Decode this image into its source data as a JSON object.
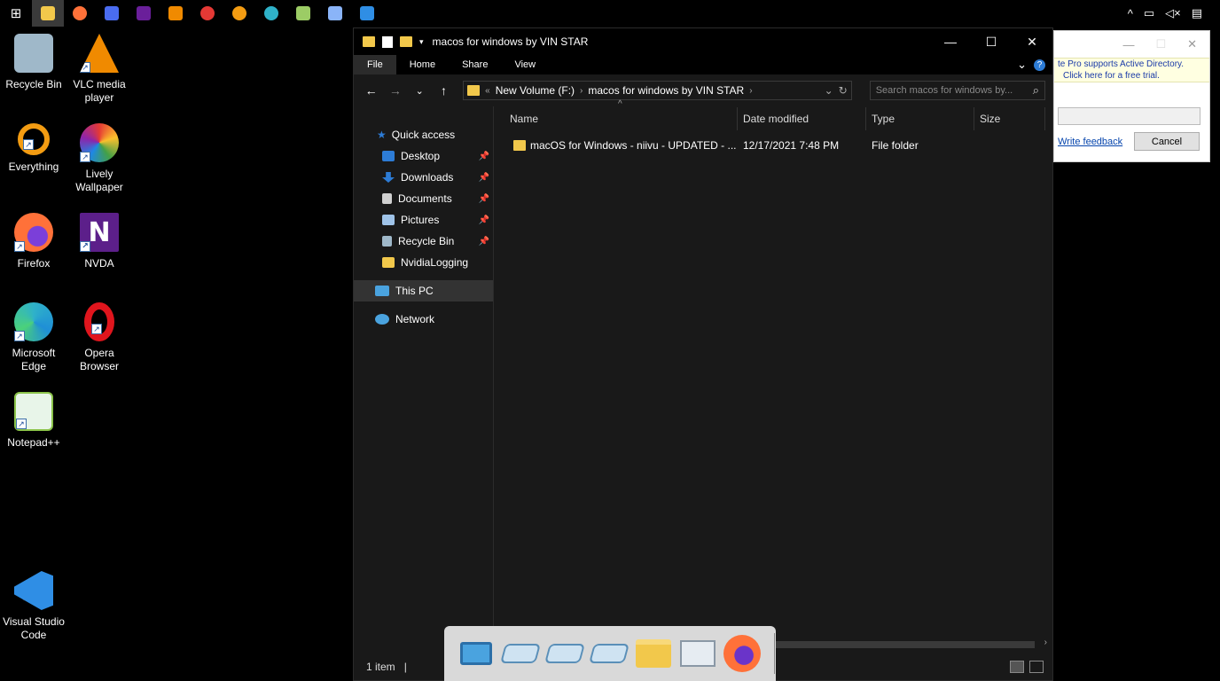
{
  "taskbar": {
    "apps": [
      {
        "name": "start-button",
        "icon": "windows-logo-icon",
        "color": "#ffffff"
      },
      {
        "name": "file-explorer",
        "icon": "folder-icon",
        "color": "#f2c84b",
        "active": true
      },
      {
        "name": "firefox",
        "icon": "firefox-icon",
        "color": "#ff7139"
      },
      {
        "name": "app-wizard",
        "icon": "wizard-icon",
        "color": "#4a6cf0"
      },
      {
        "name": "nvda",
        "icon": "nvda-icon",
        "color": "#6a1f9a"
      },
      {
        "name": "vlc",
        "icon": "vlc-icon",
        "color": "#f08a00"
      },
      {
        "name": "lively",
        "icon": "lively-icon",
        "color": "#e53935"
      },
      {
        "name": "everything",
        "icon": "everything-icon",
        "color": "#f39c12"
      },
      {
        "name": "edge",
        "icon": "edge-icon",
        "color": "#2fb2c9"
      },
      {
        "name": "notepadpp",
        "icon": "notepad-icon",
        "color": "#9ccc65"
      },
      {
        "name": "docker",
        "icon": "whale-icon",
        "color": "#8ab4f8"
      },
      {
        "name": "vscode",
        "icon": "vscode-icon",
        "color": "#2f8ee5"
      }
    ],
    "tray": {
      "chevron": "^",
      "network": "▭",
      "volume": "◁×",
      "notifications": "▤"
    }
  },
  "desktop": {
    "icons": [
      {
        "label": "Recycle Bin",
        "icon": "recycle-bin-icon",
        "color": "#9fb8c9",
        "shortcut": false
      },
      {
        "label": "VLC media player",
        "icon": "vlc-icon",
        "color": "#f08a00",
        "shortcut": true
      },
      {
        "label": "Everything",
        "icon": "everything-icon",
        "color": "#f39c12",
        "shortcut": true
      },
      {
        "label": "Lively Wallpaper",
        "icon": "lively-icon",
        "color": "#e53935",
        "shortcut": true
      },
      {
        "label": "Firefox",
        "icon": "firefox-icon",
        "color": "#ff7139",
        "shortcut": true
      },
      {
        "label": "NVDA",
        "icon": "nvda-icon",
        "color": "#5c1f8a",
        "shortcut": true
      },
      {
        "label": "Microsoft Edge",
        "icon": "edge-icon",
        "color": "#1f8fd6",
        "shortcut": true
      },
      {
        "label": "Opera Browser",
        "icon": "opera-icon",
        "color": "#e0151d",
        "shortcut": true
      },
      {
        "label": "Notepad++",
        "icon": "notepad-icon",
        "color": "#8bc34a",
        "shortcut": true
      },
      {
        "label": "Visual Studio Code",
        "icon": "vscode-icon",
        "color": "#2f8ee5",
        "shortcut": true
      }
    ]
  },
  "explorer": {
    "title": "macos for windows by VIN STAR",
    "controls": {
      "minimize": "—",
      "maximize": "☐",
      "close": "✕"
    },
    "ribbon": {
      "file": "File",
      "home": "Home",
      "share": "Share",
      "view": "View",
      "expand": "⌄",
      "help": "?"
    },
    "nav": {
      "back": "←",
      "forward": "→",
      "recent": "⌄",
      "up": "↑"
    },
    "address": {
      "root_sep": "«",
      "segment1": "New Volume (F:)",
      "sep": "›",
      "segment2": "macos for windows by VIN STAR",
      "dropdown": "⌄",
      "refresh": "↻"
    },
    "search": {
      "placeholder": "Search macos for windows by...",
      "icon": "⌕"
    },
    "navpane": {
      "quick_access": "Quick access",
      "items": [
        {
          "label": "Desktop",
          "icon": "desktop-icon",
          "color": "#2d7cd6",
          "pinned": true
        },
        {
          "label": "Downloads",
          "icon": "downloads-icon",
          "color": "#2d7cd6",
          "pinned": true
        },
        {
          "label": "Documents",
          "icon": "documents-icon",
          "color": "#d0d0d0",
          "pinned": true
        },
        {
          "label": "Pictures",
          "icon": "pictures-icon",
          "color": "#9fc3e8",
          "pinned": true
        },
        {
          "label": "Recycle Bin",
          "icon": "recycle-bin-icon",
          "color": "#9fb8c9",
          "pinned": true
        },
        {
          "label": "NvidiaLogging",
          "icon": "folder-icon",
          "color": "#f2c84b",
          "pinned": false
        }
      ],
      "this_pc": "This PC",
      "network": "Network",
      "pin_glyph": "📌"
    },
    "columns": {
      "name": "Name",
      "date": "Date modified",
      "type": "Type",
      "size": "Size",
      "sort_glyph": "^"
    },
    "files": [
      {
        "name": "macOS for Windows - niivu - UPDATED - ...",
        "date": "12/17/2021 7:48 PM",
        "type": "File folder",
        "size": ""
      }
    ],
    "status": {
      "count": "1 item",
      "separator": "|"
    }
  },
  "dialog": {
    "controls": {
      "minimize": "—",
      "maximize": "☐",
      "close": "✕"
    },
    "message_line1": "te Pro supports Active Directory.",
    "message_line2": "Click here for a free trial.",
    "feedback_link": "Write feedback",
    "cancel": "Cancel"
  },
  "dock": {
    "items": [
      {
        "icon": "monitor-icon",
        "color": "#4aa3df"
      },
      {
        "icon": "drive-icon",
        "color": "#7fb3d5"
      },
      {
        "icon": "drive-icon",
        "color": "#7fb3d5"
      },
      {
        "icon": "drive-icon",
        "color": "#7fb3d5"
      },
      {
        "icon": "folder-icon",
        "color": "#f2c84b"
      },
      {
        "icon": "screen-icon",
        "color": "#c0c8d0"
      },
      {
        "icon": "firefox-icon",
        "color": "#ff7139"
      }
    ]
  }
}
